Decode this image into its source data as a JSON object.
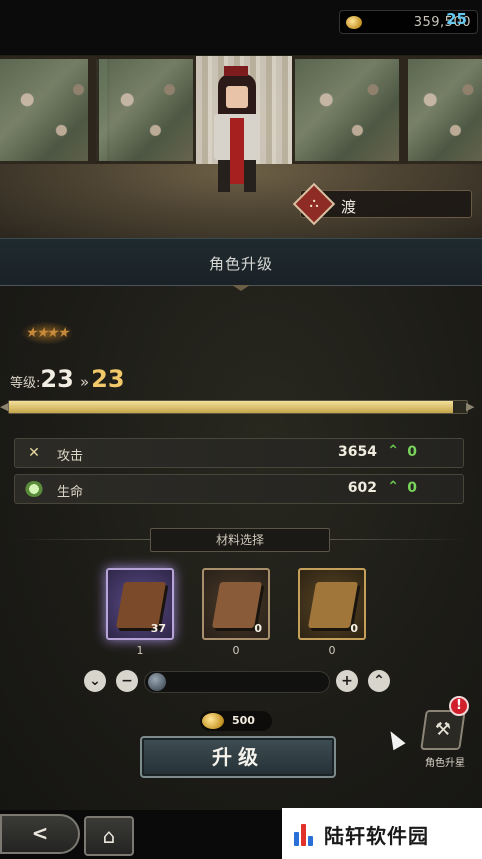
{
  "top": {
    "currency_value": "359,500",
    "level_badge": "25"
  },
  "character": {
    "name": "渡",
    "emblem_glyph": "⛬"
  },
  "panel": {
    "title": "角色升级",
    "stars_count": 4,
    "level_label": "等级:",
    "level_current": "23",
    "level_arrow": "»",
    "level_next": "23",
    "xp_progress": 0.97,
    "stats": [
      {
        "icon": "sword-icon",
        "label": "攻击",
        "value": "3654",
        "increase": "0"
      },
      {
        "icon": "heart-icon",
        "label": "生命",
        "value": "602",
        "increase": "0"
      }
    ]
  },
  "materials": {
    "title": "材料选择",
    "items": [
      {
        "name": "purple-book",
        "count": "37",
        "selected": "1",
        "color": "#7a4a2a"
      },
      {
        "name": "brown-book",
        "count": "0",
        "selected": "0",
        "color": "#8a5b38"
      },
      {
        "name": "gold-book",
        "count": "0",
        "selected": "0",
        "color": "#a0763a"
      }
    ]
  },
  "slider": {
    "value": 0
  },
  "cost": "500",
  "upgrade_button": "升级",
  "star_up": {
    "label": "角色升星",
    "badge": "!"
  },
  "bottom": {
    "back_glyph": "<",
    "home_glyph": "⌂"
  },
  "watermark": {
    "text": "陆轩软件园"
  },
  "colors": {
    "accent_gold": "#f1c86a",
    "increase_green": "#78d45a",
    "level_badge": "#63c8f0",
    "alert_red": "#d01f2a"
  }
}
